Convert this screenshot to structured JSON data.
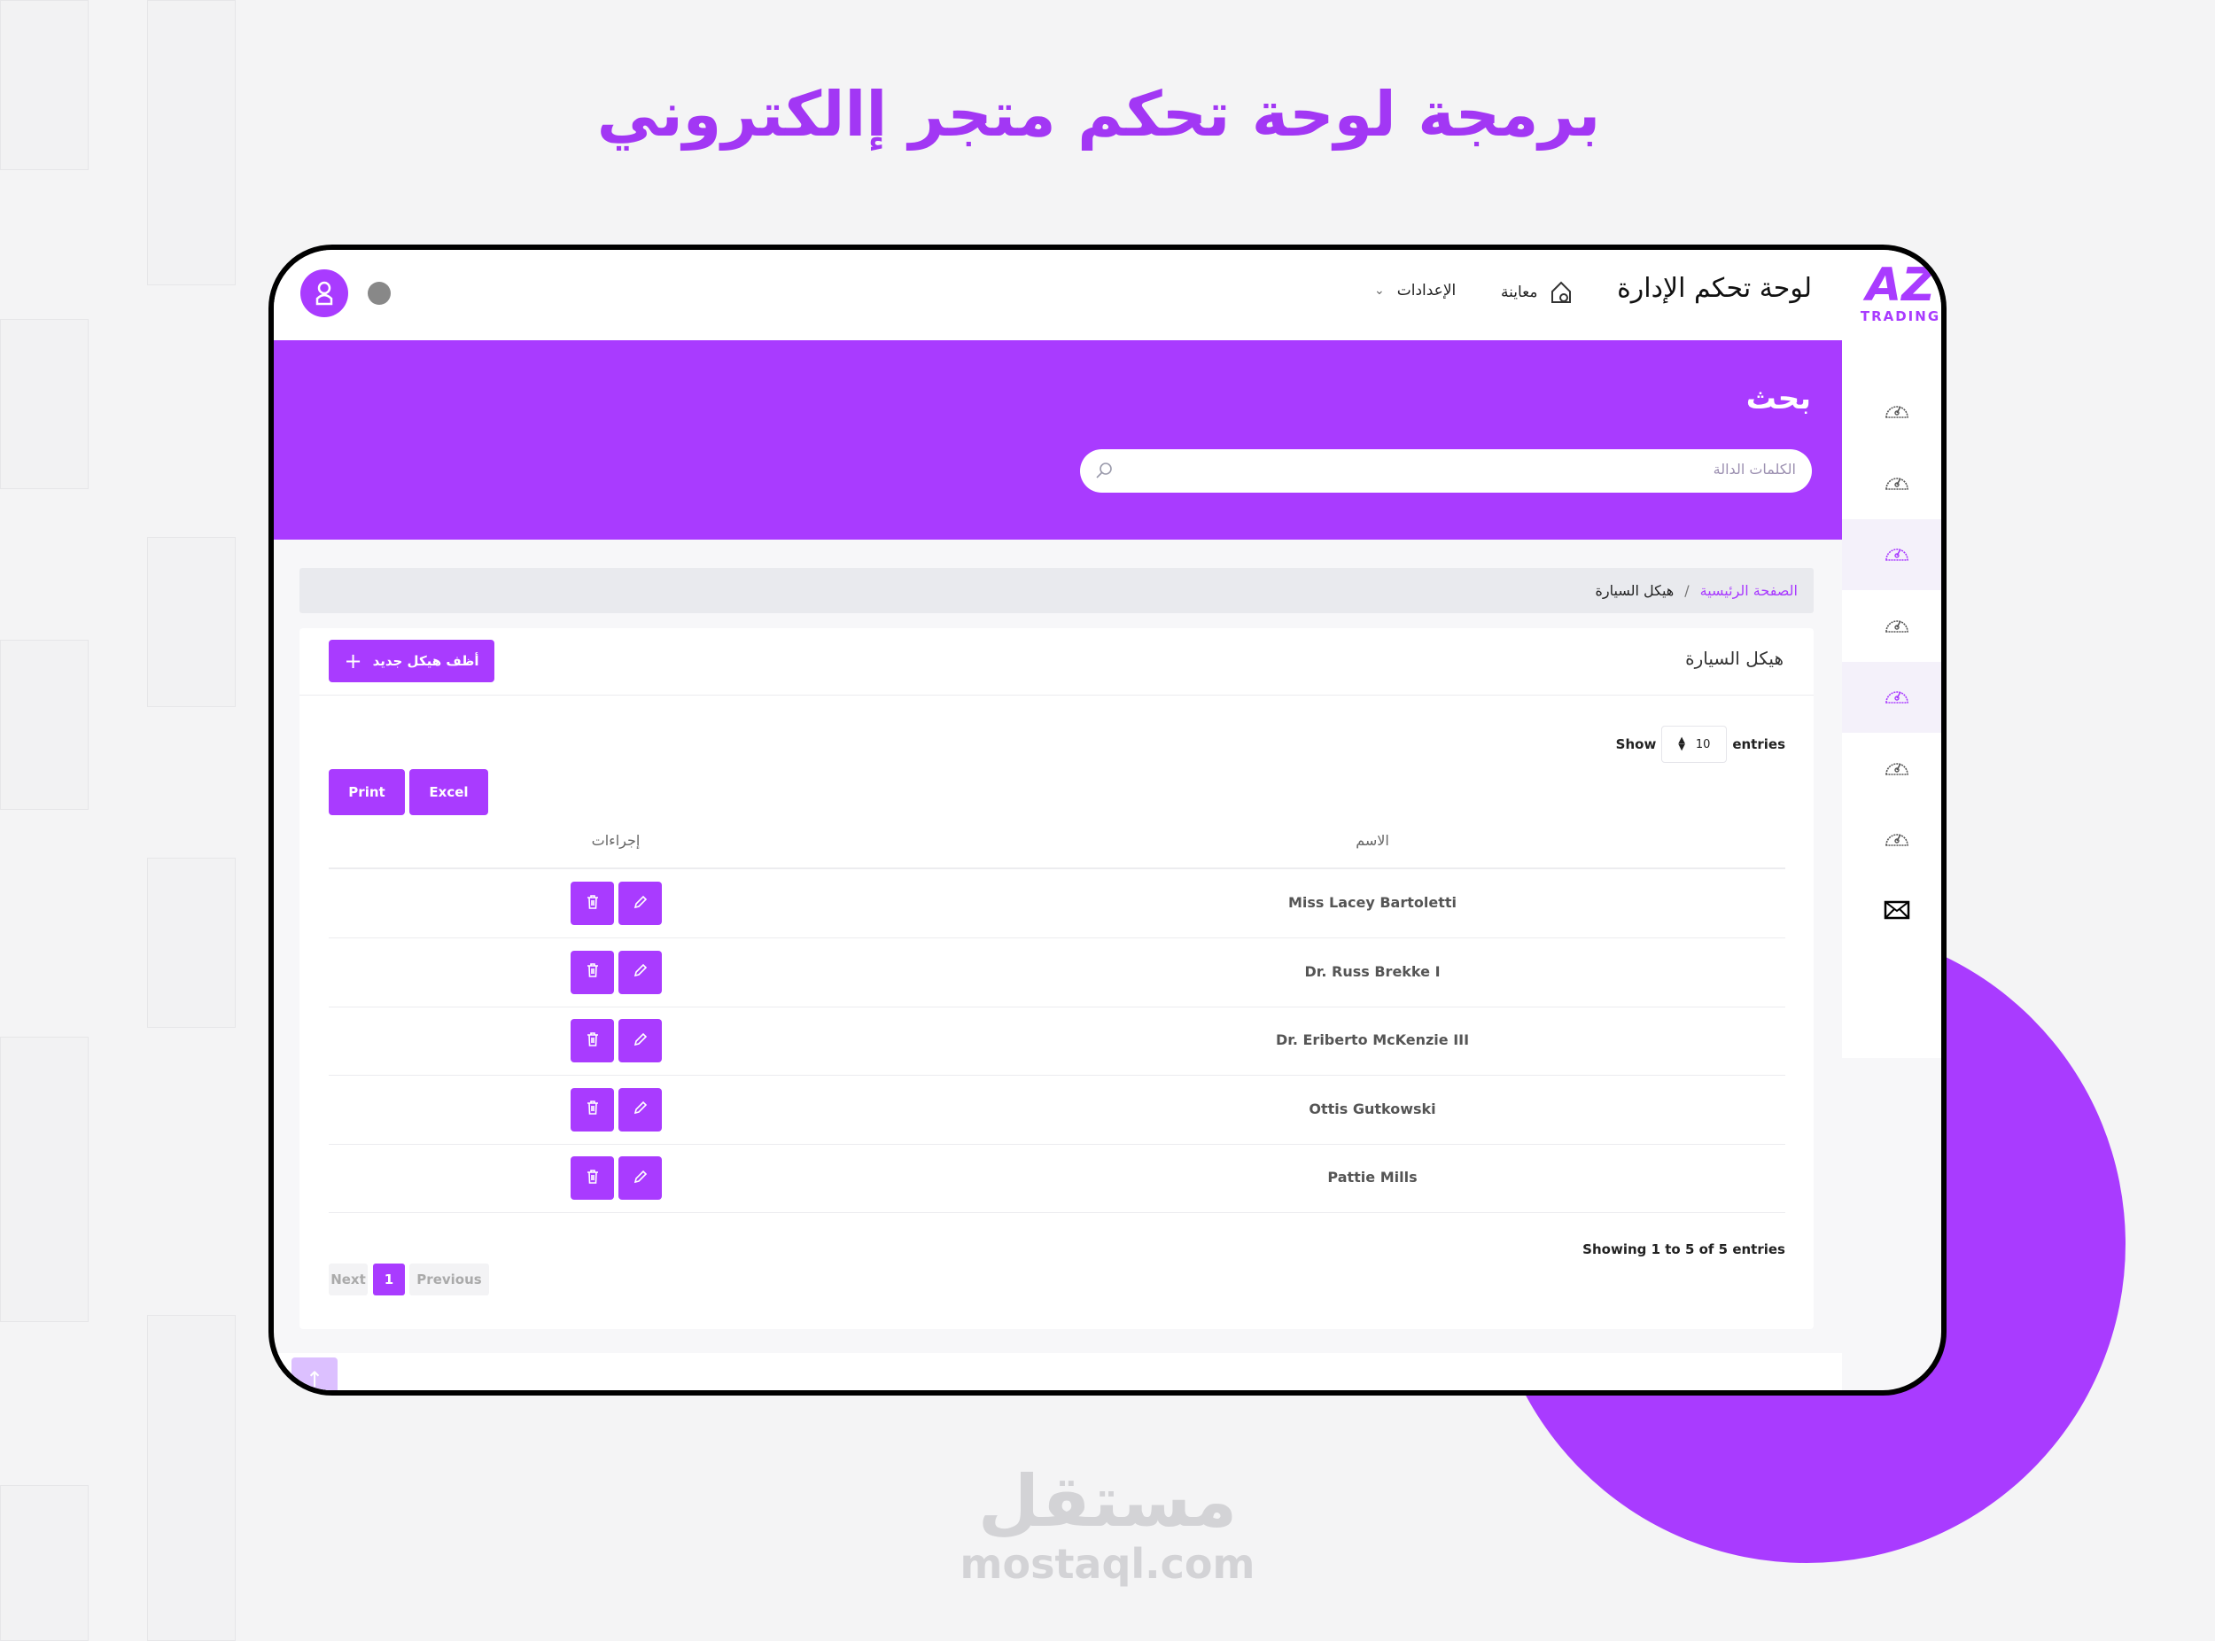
{
  "page_title": "برمجة لوحة تحكم متجر إالكتروني",
  "colors": {
    "accent": "#a93bff",
    "text": "#222222",
    "muted": "#888888"
  },
  "header": {
    "logo_text": "AZ",
    "logo_sub": "TRADING",
    "title": "لوحة تحكم الإدارة",
    "preview_label": "معاينة",
    "preview_icon": "home-icon",
    "settings_label": "الإعدادات",
    "settings_icon": "chevron-down-icon",
    "avatar_icon": "user-icon",
    "language_icon": "language-flag-icon"
  },
  "search": {
    "title": "بحث",
    "placeholder": "الكلمات الدالة",
    "icon": "search-icon"
  },
  "sidebar": {
    "items": [
      {
        "icon": "speedometer-icon",
        "active": false
      },
      {
        "icon": "speedometer-icon",
        "active": false
      },
      {
        "icon": "speedometer-icon",
        "active": true
      },
      {
        "icon": "speedometer-icon",
        "active": false
      },
      {
        "icon": "speedometer-icon",
        "active": true
      },
      {
        "icon": "speedometer-icon",
        "active": false
      },
      {
        "icon": "speedometer-icon",
        "active": false
      },
      {
        "icon": "mail-icon",
        "active": false
      }
    ]
  },
  "breadcrumb": {
    "home": "الصفحة الرئيسية",
    "separator": "/",
    "current": "هيكل السيارة"
  },
  "card": {
    "title": "هيكل السيارة",
    "add_button": "أظف هيكل جديد",
    "show_label": "Show",
    "entries_label": "entries",
    "page_size": "10",
    "export_buttons": [
      "Print",
      "Excel"
    ],
    "columns": {
      "name": "الاسم",
      "actions": "إجراءات"
    },
    "rows": [
      "Miss Lacey Bartoletti",
      "Dr. Russ Brekke I",
      "Dr. Eriberto McKenzie III",
      "Ottis Gutkowski",
      "Pattie Mills"
    ],
    "info": "Showing 1 to 5 of 5 entries",
    "pagination": {
      "next": "Next",
      "current": "1",
      "previous": "Previous"
    }
  },
  "watermark": {
    "arabic": "مستقل",
    "latin": "mostaql.com"
  }
}
